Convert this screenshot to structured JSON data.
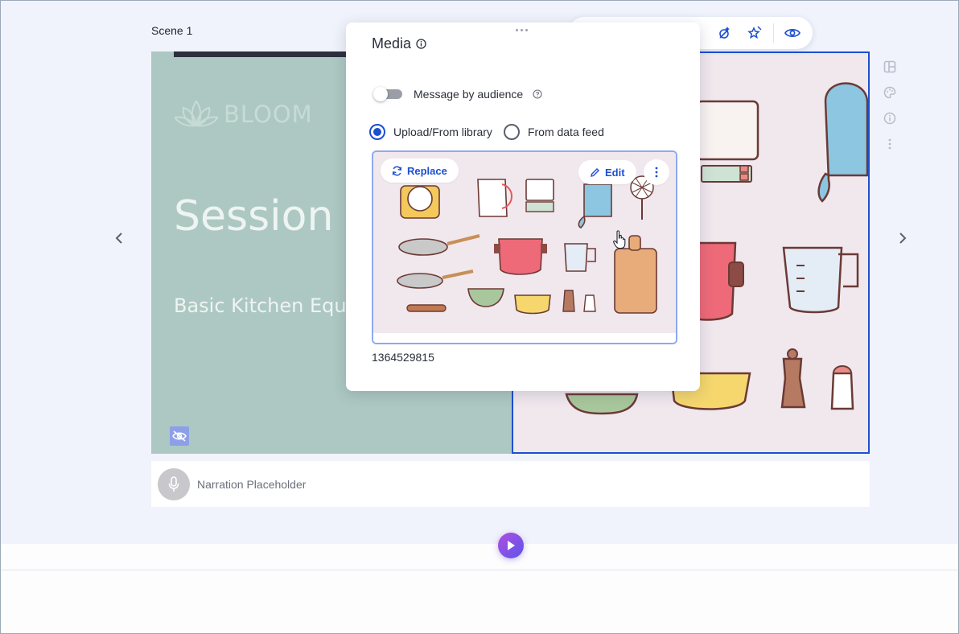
{
  "scene": {
    "label": "Scene 1"
  },
  "slide": {
    "brand": "BLOOM",
    "title": "Session #",
    "subtitle": "Basic Kitchen Equip"
  },
  "toolbar": {
    "icons": [
      "layout-icon",
      "wand-icon",
      "magic-icon",
      "eye-icon"
    ]
  },
  "side_toolbar": {
    "icons": [
      "layout-grid-icon",
      "palette-icon",
      "info-icon",
      "more-vertical-icon"
    ]
  },
  "narration": {
    "placeholder": "Narration Placeholder"
  },
  "media_panel": {
    "title": "Media",
    "toggle_label": "Message by audience",
    "toggle_on": false,
    "source_options": [
      "Upload/From library",
      "From data feed"
    ],
    "source_selected": "Upload/From library",
    "replace_label": "Replace",
    "edit_label": "Edit",
    "image_id": "1364529815"
  },
  "colors": {
    "accent": "#1d4fd1",
    "slide_left_bg": "#adc8c2",
    "slide_right_bg": "#f1e8ee",
    "play_gradient_start": "#b14ee0",
    "play_gradient_end": "#5a55ea"
  }
}
